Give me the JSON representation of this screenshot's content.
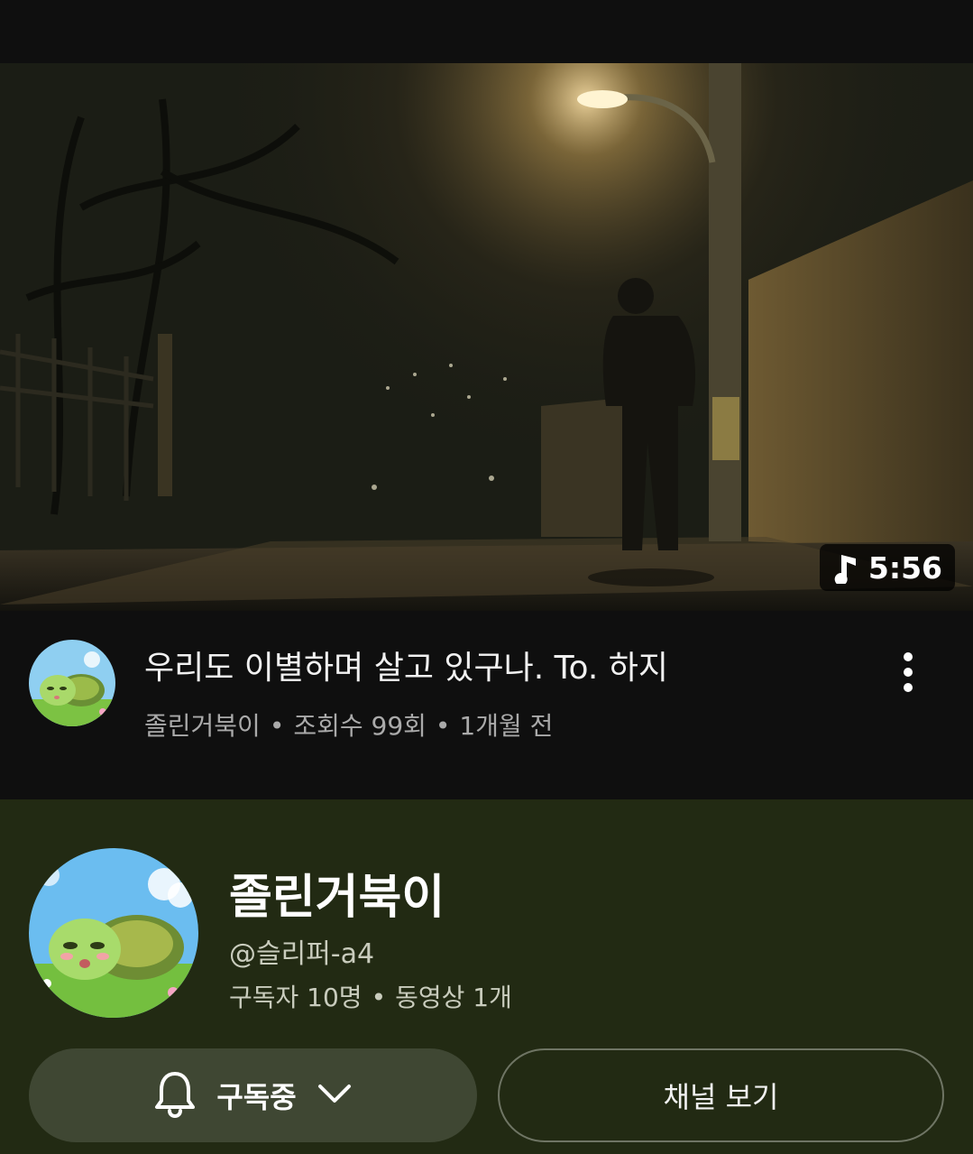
{
  "video": {
    "duration": "5:56",
    "title": "우리도 이별하며 살고 있구나. To. 하지",
    "channel": "졸린거북이",
    "views": "조회수 99회",
    "age": "1개월 전",
    "separator": "•"
  },
  "channel": {
    "name": "졸린거북이",
    "handle": "@슬리퍼-a4",
    "subscribers": "구독자 10명",
    "videos": "동영상 1개",
    "separator": "•",
    "subscribe_label": "구독중",
    "view_channel_label": "채널 보기"
  },
  "icons": {
    "duration": "music-note-icon",
    "more": "more-vertical-icon",
    "subscribe": "bell-icon",
    "dropdown": "chevron-down-icon"
  },
  "colors": {
    "background": "#0f0f0f",
    "channel_card": "#222a13",
    "subscribe_button": "#3f4733",
    "meta_text": "#aaaaaa"
  }
}
